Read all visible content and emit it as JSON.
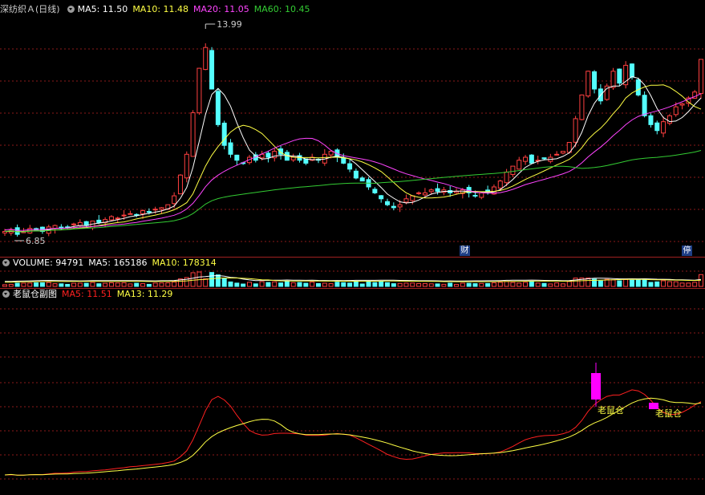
{
  "price_header": {
    "stock_name": "深纺织Ａ",
    "period": "(日线)",
    "ma5": "MA5: 11.50",
    "ma10": "MA10: 11.48",
    "ma20": "MA20: 11.05",
    "ma60": "MA60: 10.45"
  },
  "volume_header": {
    "volume": "VOLUME: 94791",
    "ma5": "MA5: 165186",
    "ma10": "MA10: 178314"
  },
  "indicator_header": {
    "name": "老鼠仓副图",
    "ma5": "MA5: 11.51",
    "ma13": "MA13: 11.29"
  },
  "markers": {
    "high_label": "13.99",
    "low_label": "6.85",
    "finance_tag": "财",
    "suspend_tag": "停",
    "signal_label_1": "老鼠仓",
    "signal_label_2": "老鼠仓"
  },
  "colors": {
    "up": "#ff4040",
    "down": "#54ffff",
    "ma5": "#ffffff",
    "ma10": "#ffff44",
    "ma20": "#ff44ff",
    "ma60": "#33cc33",
    "grid": "#8b1a1a",
    "indicator_ma5": "#ff2020",
    "indicator_ma13": "#ffff44",
    "signal": "#ff00ff"
  },
  "chart_data": {
    "type": "candlestick",
    "price_range": [
      6.85,
      13.99
    ],
    "high": 13.99,
    "low": 6.85,
    "latest": {
      "ma5": 11.5,
      "ma10": 11.48,
      "ma20": 11.05,
      "ma60": 10.45
    },
    "closes": [
      7.0,
      7.05,
      6.9,
      7.0,
      7.1,
      7.05,
      7.0,
      7.15,
      7.2,
      7.1,
      7.15,
      7.25,
      7.3,
      7.2,
      7.35,
      7.3,
      7.4,
      7.5,
      7.45,
      7.55,
      7.6,
      7.55,
      7.7,
      7.65,
      7.75,
      7.8,
      7.9,
      8.2,
      8.9,
      9.6,
      11.0,
      12.5,
      13.2,
      11.8,
      10.6,
      9.9,
      9.6,
      9.4,
      9.3,
      9.5,
      9.4,
      9.6,
      9.5,
      9.7,
      9.6,
      9.4,
      9.5,
      9.4,
      9.3,
      9.5,
      9.4,
      9.6,
      9.7,
      9.5,
      9.3,
      9.1,
      8.8,
      8.7,
      8.5,
      8.3,
      8.1,
      7.9,
      7.8,
      7.9,
      8.1,
      8.2,
      8.3,
      8.3,
      8.4,
      8.35,
      8.4,
      8.3,
      8.35,
      8.4,
      8.3,
      8.2,
      8.3,
      8.35,
      8.5,
      8.7,
      9.0,
      9.2,
      9.4,
      9.5,
      9.3,
      9.4,
      9.45,
      9.5,
      9.6,
      9.7,
      10.0,
      10.8,
      11.6,
      12.4,
      11.8,
      11.4,
      11.9,
      12.4,
      12.0,
      12.6,
      12.2,
      11.6,
      10.9,
      10.6,
      10.4,
      10.7,
      10.9,
      11.2,
      11.3,
      11.5,
      11.7,
      12.8
    ],
    "ma5": [
      7.0,
      7.01,
      6.99,
      6.99,
      7.01,
      7.02,
      7.02,
      7.06,
      7.1,
      7.1,
      7.12,
      7.17,
      7.2,
      7.2,
      7.25,
      7.28,
      7.31,
      7.35,
      7.4,
      7.44,
      7.5,
      7.53,
      7.57,
      7.61,
      7.65,
      7.69,
      7.76,
      7.85,
      8.12,
      8.48,
      9.16,
      10.04,
      10.94,
      11.62,
      11.82,
      11.6,
      11.22,
      10.66,
      10.16,
      9.74,
      9.54,
      9.44,
      9.46,
      9.54,
      9.56,
      9.56,
      9.54,
      9.52,
      9.44,
      9.42,
      9.42,
      9.44,
      9.5,
      9.54,
      9.5,
      9.44,
      9.28,
      9.08,
      8.88,
      8.68,
      8.48,
      8.26,
      8.12,
      8.0,
      7.96,
      7.98,
      8.06,
      8.16,
      8.26,
      8.31,
      8.35,
      8.35,
      8.36,
      8.36,
      8.35,
      8.31,
      8.31,
      8.31,
      8.33,
      8.41,
      8.57,
      8.75,
      8.96,
      9.16,
      9.28,
      9.36,
      9.41,
      9.43,
      9.45,
      9.53,
      9.65,
      9.92,
      10.34,
      10.9,
      11.32,
      11.6,
      11.82,
      11.9,
      11.9,
      12.06,
      12.22,
      12.16,
      11.94,
      11.58,
      11.14,
      10.84,
      10.7,
      10.72,
      10.84,
      11.04,
      11.28,
      11.5
    ],
    "ma10": [
      7.0,
      7.01,
      6.99,
      7.0,
      7.02,
      7.02,
      7.02,
      7.03,
      7.05,
      7.05,
      7.07,
      7.09,
      7.11,
      7.13,
      7.17,
      7.2,
      7.24,
      7.27,
      7.3,
      7.32,
      7.37,
      7.42,
      7.46,
      7.51,
      7.55,
      7.6,
      7.66,
      7.73,
      7.84,
      7.97,
      8.27,
      8.74,
      9.2,
      9.57,
      9.86,
      10.11,
      10.35,
      10.5,
      10.58,
      10.53,
      10.43,
      10.3,
      10.09,
      9.87,
      9.66,
      9.55,
      9.5,
      9.49,
      9.49,
      9.49,
      9.48,
      9.49,
      9.5,
      9.5,
      9.48,
      9.45,
      9.41,
      9.34,
      9.25,
      9.14,
      9.02,
      8.84,
      8.65,
      8.46,
      8.3,
      8.2,
      8.15,
      8.13,
      8.13,
      8.14,
      8.16,
      8.2,
      8.25,
      8.3,
      8.34,
      8.35,
      8.34,
      8.34,
      8.35,
      8.38,
      8.44,
      8.53,
      8.64,
      8.75,
      8.85,
      8.94,
      9.04,
      9.14,
      9.24,
      9.33,
      9.43,
      9.6,
      9.82,
      10.1,
      10.31,
      10.48,
      10.7,
      10.97,
      11.2,
      11.5,
      11.67,
      11.78,
      11.87,
      11.93,
      11.93,
      11.94,
      11.86,
      11.72,
      11.56,
      11.36,
      11.21,
      11.12
    ]
  }
}
